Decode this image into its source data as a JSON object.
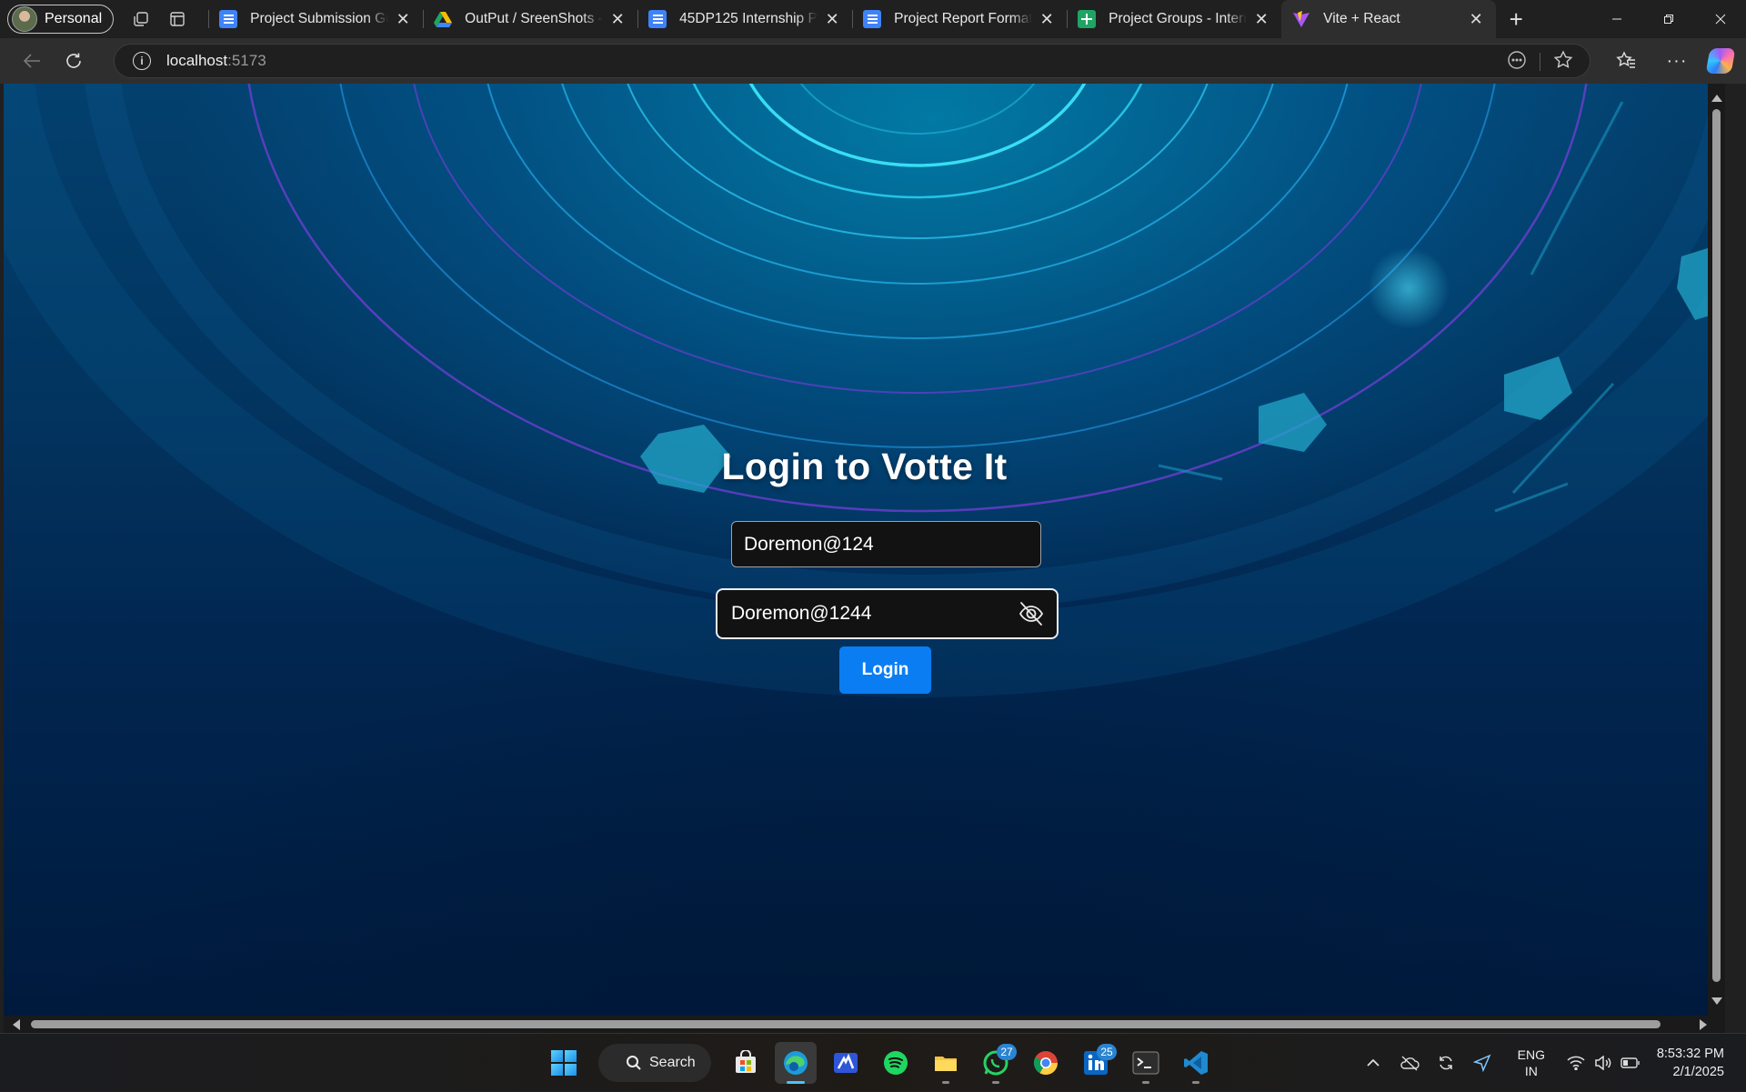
{
  "browser": {
    "profile_label": "Personal",
    "tabs": [
      {
        "title": "Project Submission Guid",
        "favicon": "docs-icon",
        "color": "#3f83f8"
      },
      {
        "title": "OutPut / SreenShots - G",
        "favicon": "drive-icon",
        "color": "#fbbc04"
      },
      {
        "title": "45DP125 Internship Pro",
        "favicon": "docs-icon",
        "color": "#3f83f8"
      },
      {
        "title": "Project Report Format -",
        "favicon": "docs-icon",
        "color": "#3f83f8"
      },
      {
        "title": "Project Groups - Interns",
        "favicon": "sheets-icon",
        "color": "#1fa463"
      },
      {
        "title": "Vite + React",
        "favicon": "vite-icon",
        "color": "#a855f7",
        "active": true
      }
    ],
    "url_host": "localhost",
    "url_port": ":5173"
  },
  "page": {
    "title": "Login to Votte It",
    "email_value": "Doremon@124",
    "password_value": "Doremon@1244",
    "login_button": "Login",
    "accent_color": "#0a7df2"
  },
  "taskbar": {
    "search_label": "Search",
    "whatsapp_badge": "27",
    "linkedin_badge": "25",
    "lang_line1": "ENG",
    "lang_line2": "IN",
    "time": "8:53:32 PM",
    "date": "2/1/2025"
  }
}
